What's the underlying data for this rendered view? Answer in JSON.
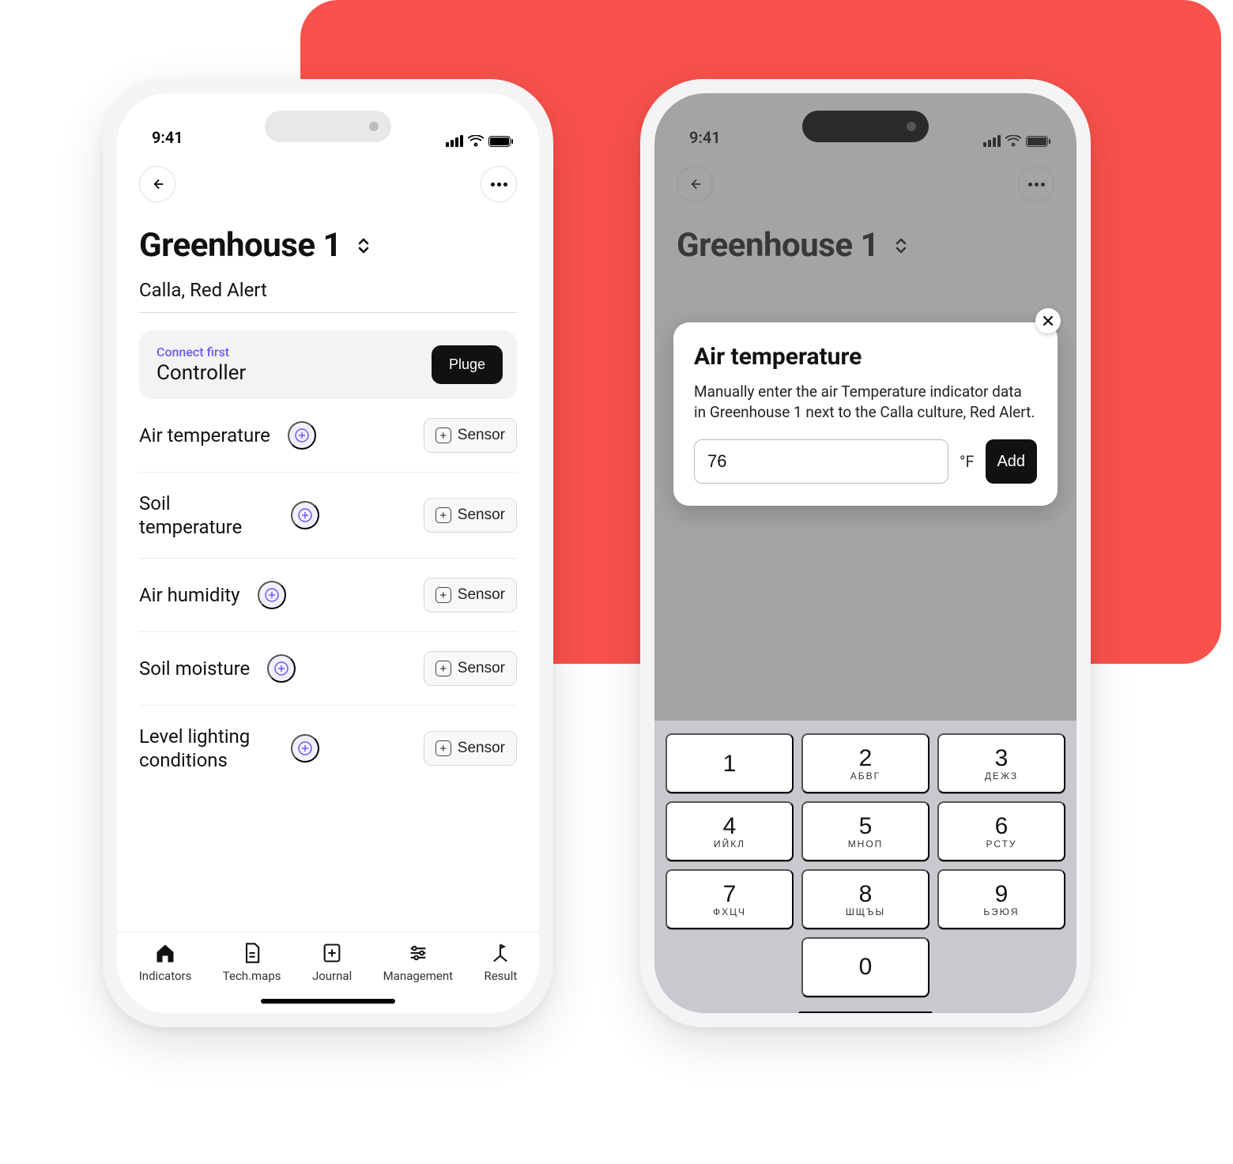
{
  "status": {
    "time": "9:41"
  },
  "page": {
    "title": "Greenhouse 1",
    "subtitle": "Calla, Red Alert"
  },
  "controller": {
    "hint": "Connect first",
    "name": "Controller",
    "button": "Pluge"
  },
  "sensor_button_label": "Sensor",
  "indicators": [
    {
      "label": "Air temperature"
    },
    {
      "label": "Soil temperature"
    },
    {
      "label": "Air humidity"
    },
    {
      "label": "Soil moisture"
    },
    {
      "label": "Level lighting conditions"
    }
  ],
  "tabs": [
    {
      "label": "Indicators"
    },
    {
      "label": "Tech.maps"
    },
    {
      "label": "Journal"
    },
    {
      "label": "Management"
    },
    {
      "label": "Result"
    }
  ],
  "modal": {
    "title": "Air temperature",
    "description": "Manually enter the air Temperature indicator data in Greenhouse 1 next to the Calla culture, Red Alert.",
    "value": "76",
    "unit": "°F",
    "add": "Add"
  },
  "keypad": [
    {
      "digit": "1",
      "sub": ""
    },
    {
      "digit": "2",
      "sub": "АБВГ"
    },
    {
      "digit": "3",
      "sub": "ДЕЖЗ"
    },
    {
      "digit": "4",
      "sub": "ИЙКЛ"
    },
    {
      "digit": "5",
      "sub": "МНОП"
    },
    {
      "digit": "6",
      "sub": "РСТУ"
    },
    {
      "digit": "7",
      "sub": "ФХЦЧ"
    },
    {
      "digit": "8",
      "sub": "ШЩЪЫ"
    },
    {
      "digit": "9",
      "sub": "ЬЭЮЯ"
    },
    {
      "digit": "0",
      "sub": ""
    }
  ]
}
